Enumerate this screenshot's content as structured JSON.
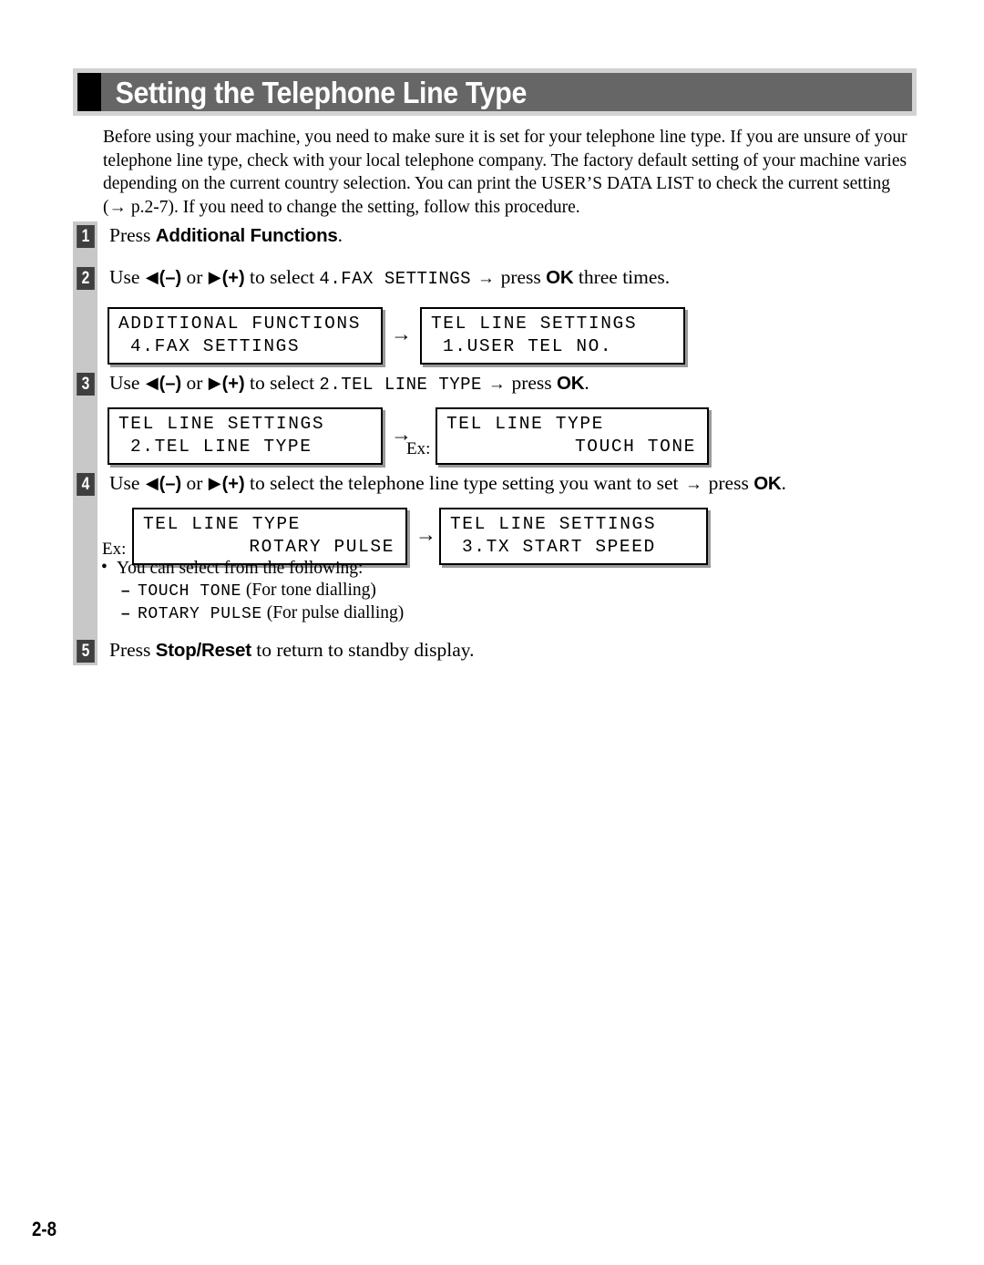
{
  "header": {
    "title": "Setting the Telephone Line Type"
  },
  "intro": {
    "paragraph": "Before using your machine, you need to make sure it is set for your telephone line type. If you are unsure of your telephone line type, check with your local telephone company. The factory default setting of your machine varies depending on the current country selection. You can print the USER’S DATA LIST to check the current setting (→ p.2-7). If you need to change the setting, follow this procedure."
  },
  "steps": {
    "one": {
      "number": "1",
      "press_label": "Press ",
      "button": "Additional Functions",
      "tail": "."
    },
    "two": {
      "number": "2",
      "use_label": "Use ",
      "left_tri": "◀",
      "minus": "(–)",
      "or_label": " or ",
      "right_tri": "▶",
      "plus": "(+)",
      "to_select": " to select ",
      "menu": "4.FAX SETTINGS",
      "arrow": " → ",
      "press_label": "press ",
      "ok": "OK",
      "tail": " three times."
    },
    "three": {
      "number": "3",
      "use_label": "Use ",
      "left_tri": "◀",
      "minus": "(–)",
      "or_label": " or ",
      "right_tri": "▶",
      "plus": "(+)",
      "to_select": " to select ",
      "menu": "2.TEL LINE TYPE",
      "arrow": " → ",
      "press_label": "press ",
      "ok": "OK",
      "tail": "."
    },
    "four": {
      "number": "4",
      "use_label": "Use ",
      "left_tri": "◀",
      "minus": "(–)",
      "or_label": " or ",
      "right_tri": "▶",
      "plus": "(+)",
      "to_select": " to select the telephone line type setting you want to set ",
      "arrow": "→ ",
      "press_label": "press ",
      "ok": "OK",
      "tail": "."
    },
    "five": {
      "number": "5",
      "press_label": "Press ",
      "button": "Stop/Reset",
      "tail": " to return to standby display."
    }
  },
  "displays": {
    "step2_left": {
      "line1": "ADDITIONAL FUNCTIONS",
      "line2": "4.FAX SETTINGS"
    },
    "step2_right": {
      "line1": "TEL LINE SETTINGS",
      "line2": "1.USER TEL NO."
    },
    "step3_left": {
      "line1": "TEL LINE SETTINGS",
      "line2": "2.TEL LINE TYPE"
    },
    "step3_right": {
      "line1": "TEL LINE TYPE",
      "line2": "TOUCH TONE"
    },
    "step4_left": {
      "line1": "TEL LINE TYPE",
      "line2": "ROTARY PULSE"
    },
    "step4_right": {
      "line1": "TEL LINE SETTINGS",
      "line2": "3.TX START SPEED"
    },
    "flow_arrow": "→",
    "example_label": "Ex:"
  },
  "notes": {
    "bullet_symbol": "•",
    "dash_symbol": "–",
    "heading": "You can select from the following:",
    "items": [
      {
        "value": "TOUCH TONE",
        "description": "(For tone dialling)"
      },
      {
        "value": "ROTARY PULSE",
        "description": "(For pulse dialling)"
      }
    ]
  },
  "footer": {
    "page_number": "2-8"
  },
  "colors": {
    "banner_gray": "#666666",
    "banner_frame": "#d2d2d2",
    "rail_gray": "#c8c8c8",
    "badge_gray": "#3f3f3f",
    "shadow_gray": "#9a9a9a"
  }
}
